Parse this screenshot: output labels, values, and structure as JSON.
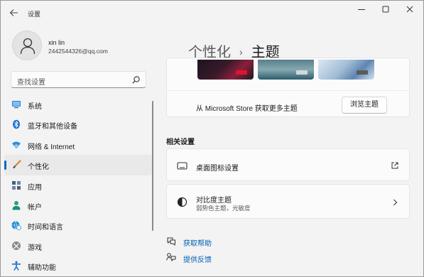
{
  "window": {
    "title": "设置"
  },
  "profile": {
    "name": "xin lin",
    "email": "2442544326@qq.com"
  },
  "search": {
    "placeholder": "查找设置"
  },
  "nav": {
    "items": [
      {
        "label": "系统",
        "icon": "monitor-icon",
        "color": "#2b7dd6"
      },
      {
        "label": "蓝牙和其他设备",
        "icon": "bluetooth-icon",
        "color": "#1a73d9"
      },
      {
        "label": "网络 & Internet",
        "icon": "wifi-icon",
        "color": "#2d8ee0"
      },
      {
        "label": "个性化",
        "icon": "brush-icon",
        "color": "#d9822b",
        "active": true
      },
      {
        "label": "应用",
        "icon": "apps-icon",
        "color": "#4a5f7a"
      },
      {
        "label": "帐户",
        "icon": "person-icon",
        "color": "#23a087"
      },
      {
        "label": "时间和语言",
        "icon": "globe-clock-icon",
        "color": "#1e8ad6"
      },
      {
        "label": "游戏",
        "icon": "xbox-icon",
        "color": "#7a7a7a"
      },
      {
        "label": "辅助功能",
        "icon": "accessibility-icon",
        "color": "#1c6fd1"
      }
    ]
  },
  "breadcrumb": {
    "parent": "个性化",
    "separator": "›",
    "current": "主题"
  },
  "store": {
    "text": "从 Microsoft Store 获取更多主题",
    "button": "浏览主题"
  },
  "related": {
    "title": "相关设置",
    "items": [
      {
        "title": "桌面图标设置",
        "icon": "desktop-icon",
        "action": "external-link-icon"
      },
      {
        "title": "对比度主题",
        "subtitle": "弱势色主题，光敏度",
        "icon": "contrast-icon",
        "action": "chevron-right-icon"
      }
    ]
  },
  "links": [
    {
      "label": "获取帮助",
      "icon": "help-icon"
    },
    {
      "label": "提供反馈",
      "icon": "feedback-icon"
    }
  ],
  "colors": {
    "accent": "#0067c0",
    "link": "#005fb8"
  }
}
